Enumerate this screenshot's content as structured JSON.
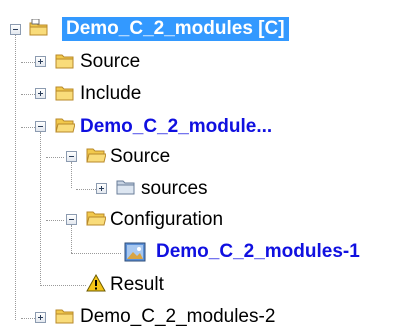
{
  "tree": {
    "root": {
      "label": "Demo_C_2_modules [C]",
      "icon": "project-folder-icon"
    },
    "nodes": [
      {
        "label": "Source"
      },
      {
        "label": "Include"
      },
      {
        "label": "Demo_C_2_module..."
      },
      {
        "label": "Source"
      },
      {
        "label": "sources"
      },
      {
        "label": "Configuration"
      },
      {
        "label": "Demo_C_2_modules-1"
      },
      {
        "label": "Result"
      },
      {
        "label": "Demo_C_2_modules-2"
      }
    ]
  },
  "colors": {
    "selection": "#3399ff",
    "highlight_text": "#1010e0",
    "folder": "#f2c94c",
    "warning": "#f5c518"
  }
}
